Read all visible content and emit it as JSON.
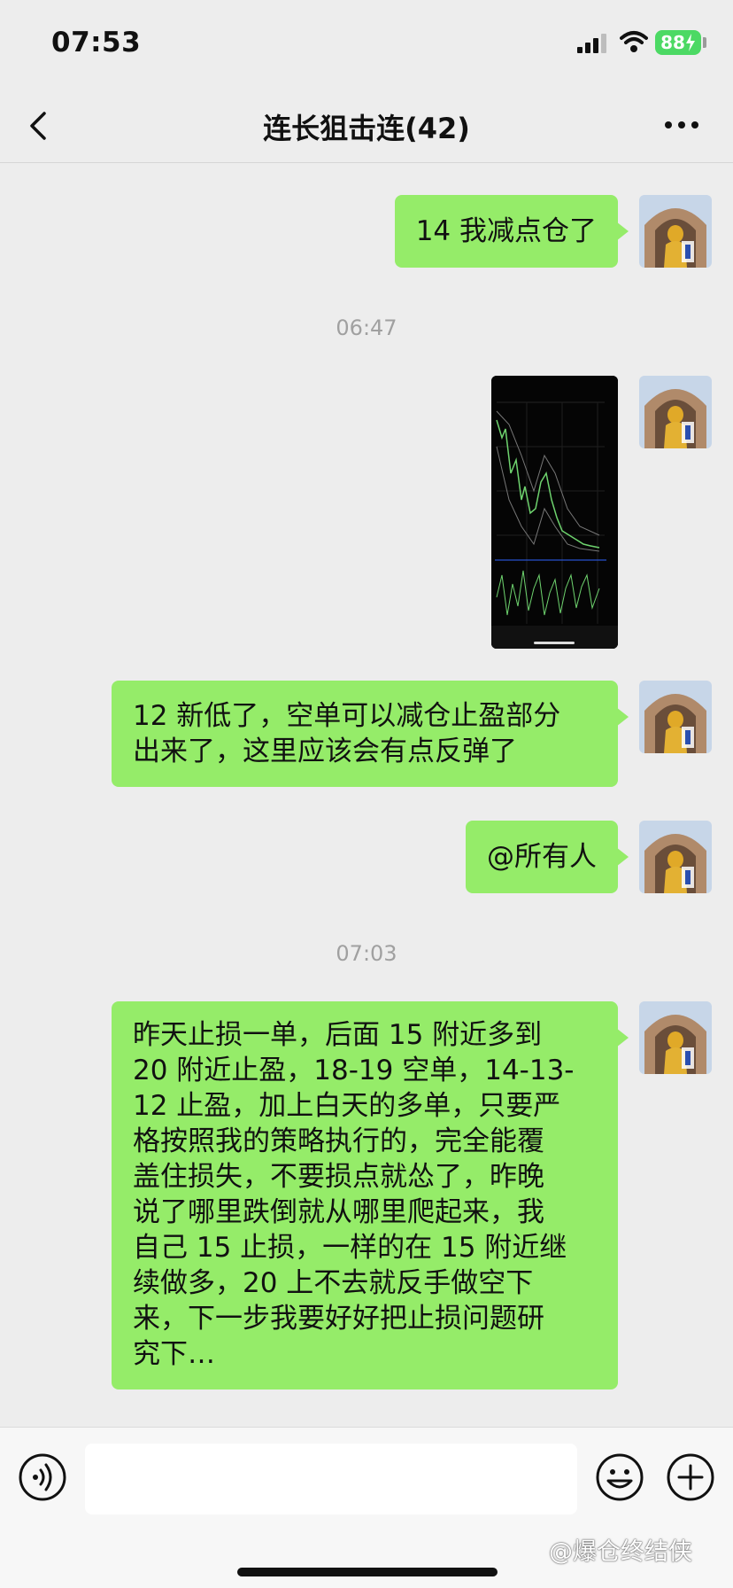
{
  "status_bar": {
    "time": "07:53",
    "battery": "88"
  },
  "nav": {
    "title": "连长狙击连(42)",
    "back_icon": "chevron-left-icon",
    "more_icon": "more-dots-icon"
  },
  "messages": [
    {
      "type": "text",
      "text": "14 我减点仓了"
    },
    {
      "type": "timestamp",
      "text": "06:47"
    },
    {
      "type": "image",
      "text": ""
    },
    {
      "type": "text",
      "lines": [
        "12 新低了，空单可以减仓止盈部分",
        "出来了，这里应该会有点反弹了"
      ]
    },
    {
      "type": "text",
      "text": "@所有人"
    },
    {
      "type": "timestamp",
      "text": "07:03"
    },
    {
      "type": "text",
      "lines": [
        "昨天止损一单，后面 15 附近多到",
        "20 附近止盈，18-19 空单，14-13-",
        "12 止盈，加上白天的多单，只要严",
        "格按照我的策略执行的，完全能覆",
        "盖住损失，不要损点就怂了，昨晚",
        "说了哪里跌倒就从哪里爬起来，我",
        "自己 15 止损，一样的在 15 附近继",
        "续做多，20 上不去就反手做空下",
        "来，下一步我要好好把止损问题研",
        "究下…"
      ]
    }
  ],
  "input_bar": {
    "placeholder": "",
    "voice_icon": "voice-icon",
    "emoji_icon": "emoji-icon",
    "plus_icon": "plus-icon"
  },
  "watermark": "@爆仓终结侠",
  "colors": {
    "bubble": "#95ec69",
    "background": "#ededed",
    "battery": "#4cd964"
  }
}
